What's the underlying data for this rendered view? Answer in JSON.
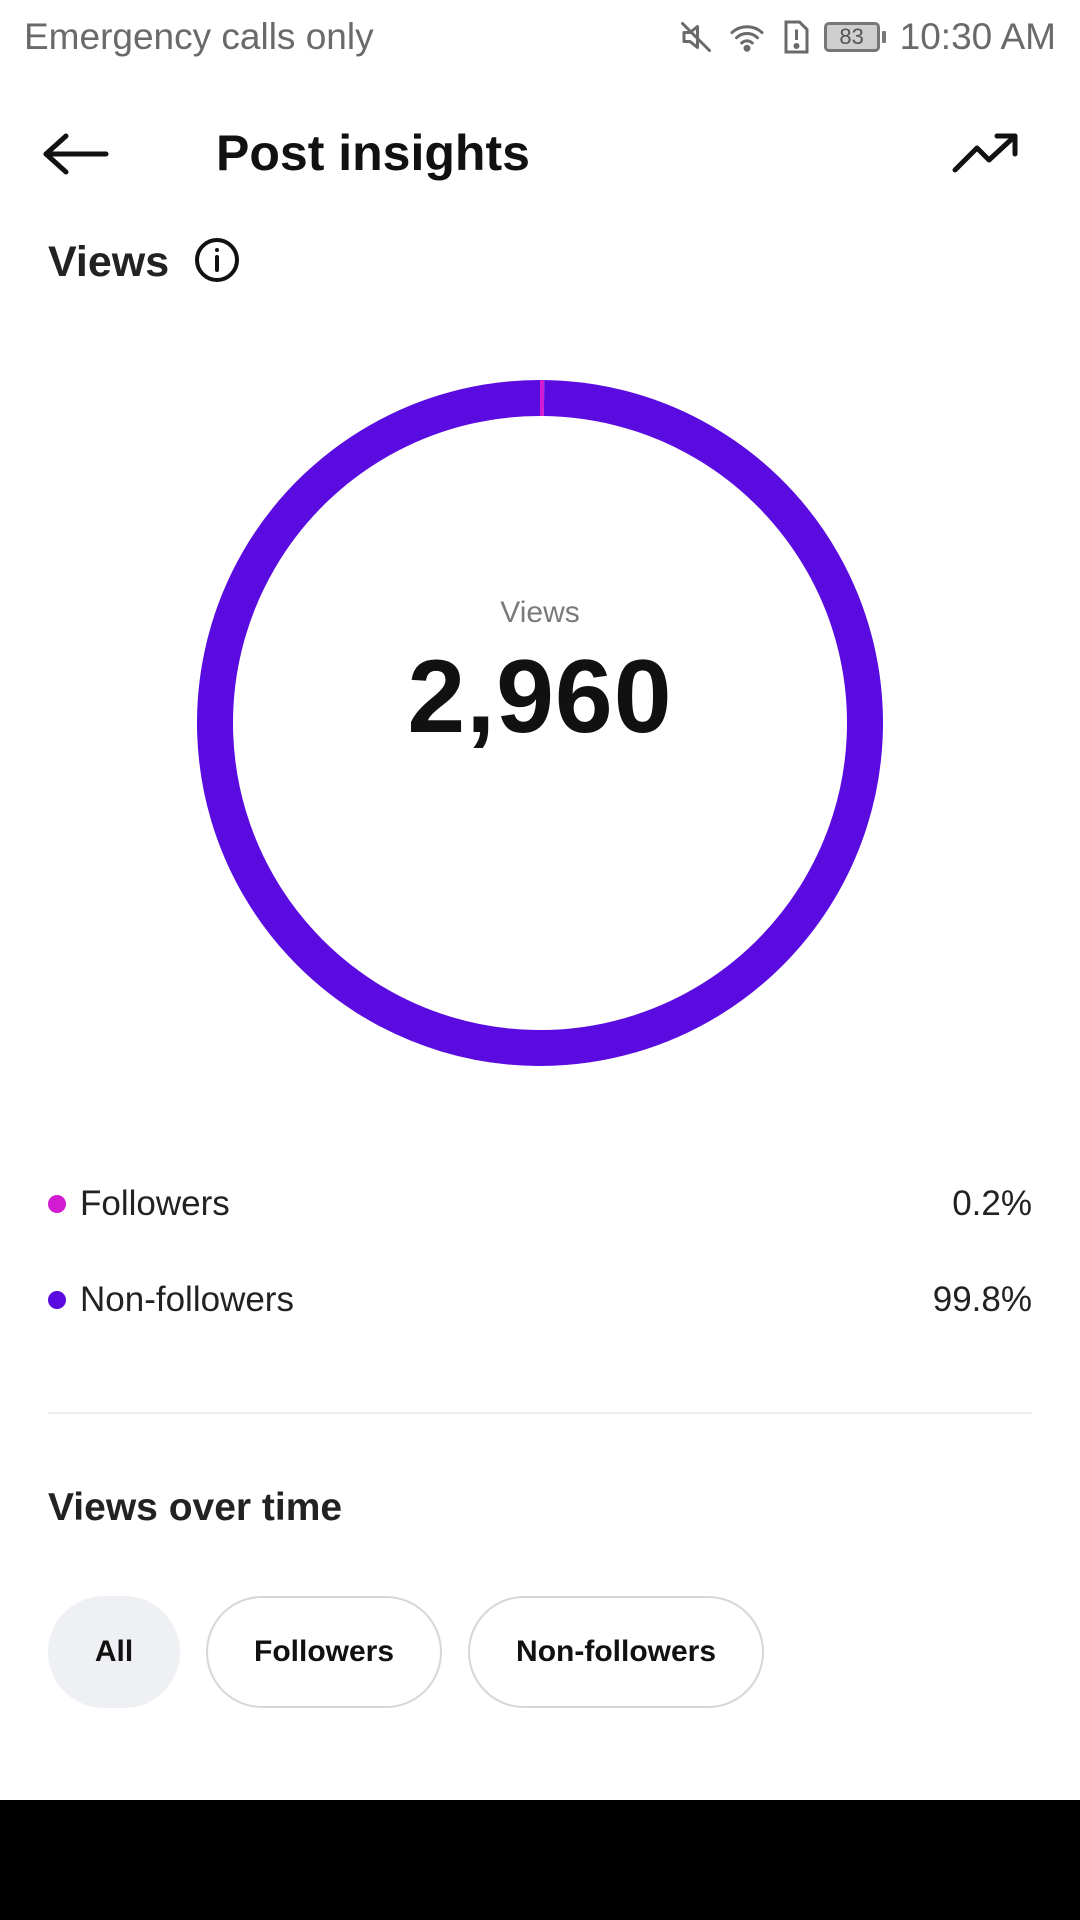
{
  "status_bar": {
    "carrier_text": "Emergency calls only",
    "battery": "83",
    "time": "10:30 AM",
    "icons": [
      "mute-icon",
      "wifi-icon",
      "sim-alert-icon",
      "battery-icon"
    ]
  },
  "header": {
    "title": "Post insights",
    "back_icon": "arrow-left-icon",
    "trend_icon": "trending-up-icon"
  },
  "views_section": {
    "title": "Views",
    "info_icon": "info-icon"
  },
  "donut": {
    "center_label": "Views",
    "center_value": "2,960"
  },
  "chart_data": {
    "type": "pie",
    "style": "donut",
    "title": "",
    "total_label": "Views",
    "total": 2960,
    "slices": [
      {
        "name": "Followers",
        "percent": 0.2,
        "color": "#d31bd1"
      },
      {
        "name": "Non-followers",
        "percent": 99.8,
        "color": "#5a0ce0"
      }
    ]
  },
  "legend": [
    {
      "label": "Followers",
      "value": "0.2%",
      "color": "#d31bd1"
    },
    {
      "label": "Non-followers",
      "value": "99.8%",
      "color": "#5a0ce0"
    }
  ],
  "over_time": {
    "title": "Views over time",
    "filters": [
      {
        "label": "All",
        "selected": true
      },
      {
        "label": "Followers",
        "selected": false
      },
      {
        "label": "Non-followers",
        "selected": false
      }
    ]
  },
  "colors": {
    "accent": "#5a0ce0",
    "followers": "#d31bd1"
  }
}
